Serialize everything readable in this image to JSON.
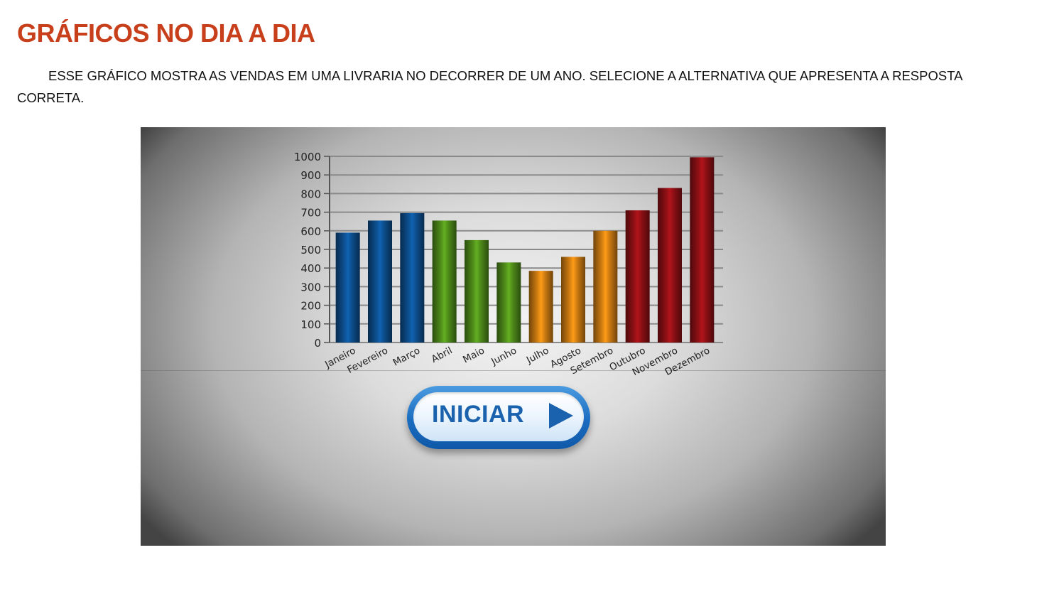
{
  "page": {
    "title": "GRÁFICOS NO DIA A DIA",
    "instructions": "ESSE GRÁFICO MOSTRA AS VENDAS EM UMA LIVRARIA NO DECORRER DE UM ANO. SELECIONE A ALTERNATIVA QUE APRESENTA A RESPOSTA CORRETA."
  },
  "activity": {
    "start_button_label": "INICIAR",
    "start_icon": "play-icon"
  },
  "colors": {
    "title": "#c8401b",
    "blue": "#0d4f8f",
    "green": "#4f8c1a",
    "orange": "#d07d12",
    "red": "#8e1015",
    "button": "#1a62ad"
  },
  "chart_data": {
    "type": "bar",
    "categories": [
      "Janeiro",
      "Fevereiro",
      "Março",
      "Abril",
      "Maio",
      "Junho",
      "Julho",
      "Agosto",
      "Setembro",
      "Outubro",
      "Novembro",
      "Dezembro"
    ],
    "values": [
      590,
      655,
      695,
      655,
      550,
      430,
      385,
      460,
      600,
      710,
      830,
      995
    ],
    "bar_colors": [
      "#0d4f8f",
      "#0d4f8f",
      "#0d4f8f",
      "#4f8c1a",
      "#4f8c1a",
      "#4f8c1a",
      "#d07d12",
      "#d07d12",
      "#d07d12",
      "#8e1015",
      "#8e1015",
      "#8e1015"
    ],
    "yticks": [
      "0",
      "100",
      "200",
      "300",
      "400",
      "500",
      "600",
      "700",
      "800",
      "900",
      "1000"
    ],
    "ylim": [
      0,
      1000
    ],
    "grid": true,
    "title": "",
    "xlabel": "",
    "ylabel": ""
  }
}
